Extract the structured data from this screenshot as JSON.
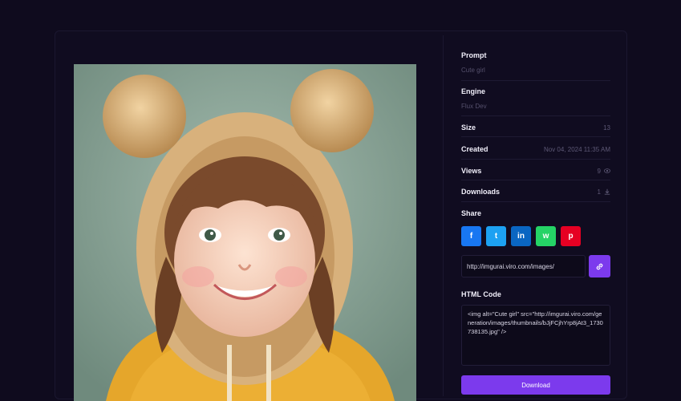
{
  "details": {
    "prompt_label": "Prompt",
    "prompt_value": "Cute girl",
    "engine_label": "Engine",
    "engine_value": "Flux Dev",
    "size_label": "Size",
    "size_value": "13",
    "created_label": "Created",
    "created_value": "Nov 04, 2024 11:35 AM",
    "views_label": "Views",
    "views_value": "9",
    "downloads_label": "Downloads",
    "downloads_value": "1"
  },
  "share": {
    "label": "Share",
    "buttons": [
      {
        "name": "facebook",
        "glyph": "f",
        "color": "#1877f2"
      },
      {
        "name": "twitter",
        "glyph": "t",
        "color": "#1da1f2"
      },
      {
        "name": "linkedin",
        "glyph": "in",
        "color": "#0a66c2"
      },
      {
        "name": "whatsapp",
        "glyph": "w",
        "color": "#25d366"
      },
      {
        "name": "pinterest",
        "glyph": "p",
        "color": "#e60023"
      }
    ],
    "url": "http://imgurai.viro.com/images/"
  },
  "html_code": {
    "label": "HTML Code",
    "value": "<img alt=\"Cute girl\" src=\"http://imgurai.viro.com/generation/images/thumbnails/bJjFCjhYrp8jAt3_1730738135.jpg\" />"
  },
  "download_label": "Download",
  "colors": {
    "accent": "#7c3aed",
    "background": "#0f0b1e"
  }
}
